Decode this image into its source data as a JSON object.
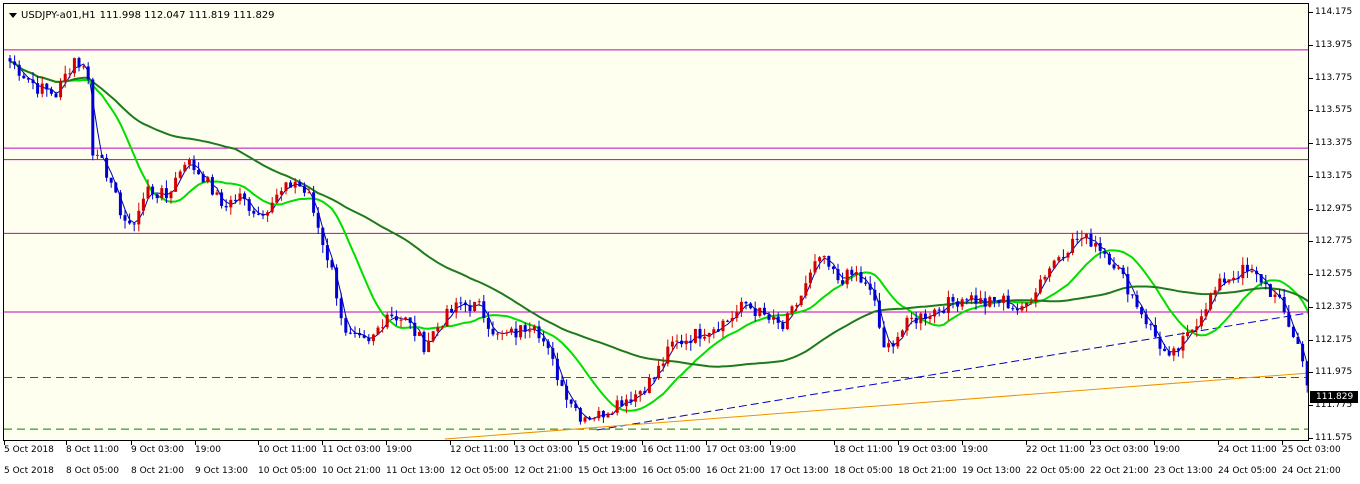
{
  "header": {
    "symbol_label": "USDJPY-a01,H1",
    "ohlc_label": "111.998 112.047 111.819 111.829"
  },
  "icons": {
    "dropdown": "triangle-down-icon"
  },
  "colors": {
    "background": "#fffff0",
    "bull_candle": "#d40000",
    "bear_candle": "#0000d4",
    "ma_fast": "#0000b0",
    "ma_medium": "#00dd00",
    "ma_slow": "#1e7a1e",
    "resistance": "#c000c0",
    "trend_blue": "#0000c8",
    "trend_orange": "#f09000",
    "support_green": "#008000"
  },
  "current_price": "111.829",
  "price_axis": {
    "min": 111.575,
    "max": 114.175,
    "ticks": [
      "114.175",
      "113.975",
      "113.775",
      "113.575",
      "113.375",
      "113.175",
      "112.975",
      "112.775",
      "112.575",
      "112.375",
      "112.175",
      "111.975",
      "111.775",
      "111.575"
    ]
  },
  "time_axis": {
    "row1": [
      "5 Oct 2018",
      "8 Oct 11:00",
      "9 Oct 03:00",
      "19:00",
      "10 Oct 11:00",
      "11 Oct 03:00",
      "19:00",
      "12 Oct 11:00",
      "13 Oct 03:00",
      "15 Oct 19:00",
      "16 Oct 11:00",
      "17 Oct 03:00",
      "19:00",
      "18 Oct 11:00",
      "19 Oct 03:00",
      "19:00",
      "22 Oct 11:00",
      "23 Oct 03:00",
      "19:00",
      "24 Oct 11:00",
      "25 Oct 03:00"
    ],
    "row2": [
      "5 Oct 2018",
      "8 Oct 05:00",
      "8 Oct 21:00",
      "9 Oct 13:00",
      "10 Oct 05:00",
      "10 Oct 21:00",
      "11 Oct 13:00",
      "12 Oct 05:00",
      "12 Oct 21:00",
      "15 Oct 13:00",
      "16 Oct 05:00",
      "16 Oct 21:00",
      "17 Oct 13:00",
      "18 Oct 05:00",
      "18 Oct 21:00",
      "19 Oct 13:00",
      "22 Oct 05:00",
      "22 Oct 21:00",
      "23 Oct 13:00",
      "24 Oct 05:00",
      "24 Oct 21:00"
    ]
  },
  "chart_data": {
    "type": "candlestick",
    "symbol": "USDJPY-a01",
    "timeframe": "H1",
    "last_bar": {
      "open": 111.998,
      "high": 112.047,
      "low": 111.819,
      "close": 111.829
    },
    "close_path": [
      [
        0,
        113.88
      ],
      [
        6,
        113.72
      ],
      [
        10,
        113.68
      ],
      [
        14,
        113.9
      ],
      [
        17,
        113.8
      ],
      [
        18,
        113.3
      ],
      [
        20,
        113.32
      ],
      [
        22,
        113.1
      ],
      [
        26,
        112.85
      ],
      [
        30,
        113.1
      ],
      [
        34,
        113.05
      ],
      [
        38,
        113.28
      ],
      [
        42,
        113.18
      ],
      [
        46,
        113.0
      ],
      [
        50,
        113.05
      ],
      [
        54,
        112.95
      ],
      [
        58,
        113.05
      ],
      [
        62,
        113.15
      ],
      [
        65,
        113.05
      ],
      [
        70,
        112.6
      ],
      [
        73,
        112.2
      ],
      [
        78,
        112.15
      ],
      [
        82,
        112.35
      ],
      [
        86,
        112.3
      ],
      [
        90,
        112.15
      ],
      [
        94,
        112.3
      ],
      [
        98,
        112.4
      ],
      [
        102,
        112.38
      ],
      [
        106,
        112.2
      ],
      [
        110,
        112.22
      ],
      [
        114,
        112.3
      ],
      [
        120,
        111.9
      ],
      [
        124,
        111.72
      ],
      [
        128,
        111.72
      ],
      [
        132,
        111.8
      ],
      [
        136,
        111.85
      ],
      [
        140,
        111.95
      ],
      [
        144,
        112.15
      ],
      [
        148,
        112.2
      ],
      [
        152,
        112.25
      ],
      [
        156,
        112.3
      ],
      [
        160,
        112.4
      ],
      [
        164,
        112.32
      ],
      [
        168,
        112.25
      ],
      [
        172,
        112.45
      ],
      [
        176,
        112.68
      ],
      [
        180,
        112.55
      ],
      [
        184,
        112.58
      ],
      [
        188,
        112.42
      ],
      [
        190,
        112.1
      ],
      [
        192,
        112.18
      ],
      [
        196,
        112.3
      ],
      [
        200,
        112.35
      ],
      [
        204,
        112.4
      ],
      [
        208,
        112.45
      ],
      [
        212,
        112.4
      ],
      [
        216,
        112.42
      ],
      [
        220,
        112.35
      ],
      [
        224,
        112.55
      ],
      [
        228,
        112.7
      ],
      [
        232,
        112.8
      ],
      [
        236,
        112.78
      ],
      [
        240,
        112.65
      ],
      [
        244,
        112.45
      ],
      [
        248,
        112.25
      ],
      [
        252,
        112.05
      ],
      [
        256,
        112.2
      ],
      [
        260,
        112.4
      ],
      [
        264,
        112.55
      ],
      [
        268,
        112.6
      ],
      [
        272,
        112.55
      ],
      [
        276,
        112.4
      ],
      [
        280,
        112.15
      ],
      [
        283,
        111.829
      ]
    ],
    "moving_averages": [
      {
        "period_hint": "fast",
        "color": "#0000b0"
      },
      {
        "period_hint": "medium",
        "color": "#00dd00"
      },
      {
        "period_hint": "slow",
        "color": "#1e7a1e"
      }
    ],
    "resistance_levels": [
      113.95,
      113.35,
      113.28,
      112.83,
      112.35
    ],
    "dashed_levels": [
      {
        "price": 111.95,
        "color": "#c000c0"
      },
      {
        "price": 111.635,
        "color": "#008000"
      }
    ],
    "trendlines": [
      {
        "color": "#0000c8",
        "from": {
          "bar": 128,
          "price": 111.63
        },
        "to": {
          "bar": 283,
          "price": 112.35
        },
        "style": "dashed"
      },
      {
        "color": "#f09000",
        "from": {
          "bar": 95,
          "price": 111.575
        },
        "to": {
          "bar": 283,
          "price": 111.98
        },
        "style": "solid"
      }
    ],
    "ylim": [
      111.575,
      114.175
    ]
  }
}
